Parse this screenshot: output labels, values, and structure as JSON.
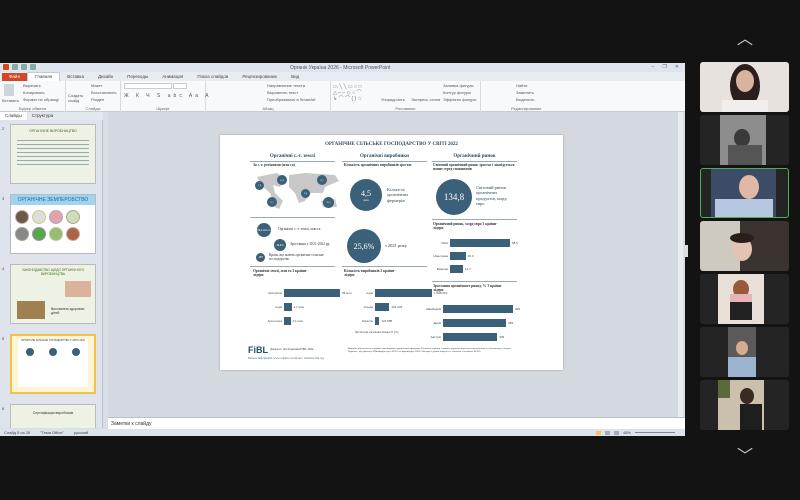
{
  "window": {
    "title": "Органік Україна 2026 - Microsoft PowerPoint",
    "controls": [
      "–",
      "❐",
      "✕"
    ]
  },
  "tabs": [
    "Файл",
    "Главная",
    "Вставка",
    "Дизайн",
    "Переходы",
    "Анимация",
    "Показ слайдов",
    "Рецензирование",
    "Вид"
  ],
  "ribbon": {
    "clipboard": {
      "paste": "Вставить",
      "cut": "Вырезать",
      "copy": "Копировать",
      "format": "Формат по образцу",
      "label": "Буфер обмена"
    },
    "slides": {
      "new": "Создать слайд",
      "layout": "Макет",
      "reset": "Восстановить",
      "section": "Раздел",
      "label": "Слайды"
    },
    "font": {
      "label": "Шрифт"
    },
    "paragraph": {
      "dir": "Направление текста",
      "align": "Выровнять текст",
      "smartart": "Преобразовать в SmartArt",
      "label": "Абзац"
    },
    "drawing": {
      "arrange": "Упорядочить",
      "styles": "Экспресс-стили",
      "fill": "Заливка фигуры",
      "outline": "Контур фигуры",
      "effects": "Эффекты фигуры",
      "label": "Рисование"
    },
    "editing": {
      "find": "Найти",
      "replace": "Заменить",
      "select": "Выделить",
      "label": "Редактирование"
    }
  },
  "panes": {
    "slides_tab": "Слайды",
    "outline_tab": "Структура"
  },
  "thumbnails": [
    {
      "num": "2",
      "title": "ОРГАНІЧНЕ ВИРОБНИЦТВО"
    },
    {
      "num": "3",
      "title": "ОРГАНІЧНЕ ЗЕМЛЕРОБСТВО"
    },
    {
      "num": "4",
      "title": "ЗАКОНОДАВСТВО ЩОДО ОРГАНІЧНОГО ВИРОБНИЦТВА",
      "caption": "Виховання здорових дітей"
    },
    {
      "num": "5",
      "title": "ОРГАНІЧНЕ СІЛЬСЬКЕ ГОСПОДАРСТВО У СВІТІ 2022"
    },
    {
      "num": "6",
      "title": "Сертифікація виробників"
    }
  ],
  "slide": {
    "title": "ОРГАНІЧНЕ СІЛЬСЬКЕ ГОСПОДАРСТВО У СВІТІ 2022",
    "col1": {
      "header": "Органічні с.-г. землі",
      "sub": "За с.-г. регіонами (млн га)",
      "regions": [
        "7,6",
        "10,5",
        "9,7",
        "2,7",
        "9,8",
        "35,2"
      ],
      "land_value": "96,4 млн га",
      "land_text": "Органічні с.-г. землі, млн га",
      "growth_value": "26,6%",
      "growth_text": "Зростання у 2021-2022 рр",
      "countries_value": "188",
      "countries_text": "Країн, що мають органічне сільське господарство",
      "chart_title": "Органічні землі, млн га 3 країни-лідери",
      "bars": [
        {
          "label": "Австралія",
          "value": 35,
          "text": "35 млн"
        },
        {
          "label": "Індія",
          "value": 4.7,
          "text": "4,7 млн"
        },
        {
          "label": "Аргентина",
          "value": 4.1,
          "text": "4,1 млн"
        }
      ]
    },
    "col2": {
      "header": "Органічні виробники",
      "sub": "Кількість органічних виробників зростає",
      "farmers_value": "4,5",
      "farmers_unit": "млн",
      "farmers_text": "Кількість органічних фермерів",
      "growth_value": "25,6%",
      "growth_text": "з 2021 року",
      "chart_title": "Кількість виробників 3 країни-лідери",
      "bars": [
        {
          "label": "Індія",
          "value": 1599010,
          "text": "1 599 010"
        },
        {
          "label": "Уганда",
          "value": 404246,
          "text": "404 246"
        },
        {
          "label": "Ефіопія",
          "value": 121685,
          "text": "121 685"
        }
      ],
      "note": "Частка від загальної кількості (%)"
    },
    "col3": {
      "header": "Органічний ринок",
      "sub": "Світовий органічний ринок зростає і ліквідується попит серед споживачів",
      "market_value": "134,8",
      "market_text": "Світовий ринок органічних продуктів, млрд євро",
      "chart1_title": "Органічний ринок, млрд євро 3 країни-лідери",
      "bars1": [
        {
          "label": "США",
          "value": 58.6,
          "text": "58,6"
        },
        {
          "label": "Німеччина",
          "value": 15.3,
          "text": "15,3"
        },
        {
          "label": "Франція",
          "value": 12.7,
          "text": "12,7"
        }
      ],
      "chart2_title": "Зростання органічного ринку, % 3 країни-лідери",
      "bars2": [
        {
          "label": "Швейцарія",
          "value": 425,
          "text": "425"
        },
        {
          "label": "Данія",
          "value": 384,
          "text": "384"
        },
        {
          "label": "Австрія",
          "value": 329,
          "text": "329"
        }
      ]
    },
    "logo": "FiBL",
    "source": "Джерело: Дослідження FiBL 2024",
    "more": "Більше інформації: www.organic-world.net / statistics.fibl.org",
    "footnote": "Видання підготовлене в рамках швейцарсько-української програми «Розвиток торгівлі з вищою доданою вартістю в органічному та молочному секторах України», яку фінансує Швейцарія через SECO та впроваджує FiBL. Погляди і думки можуть не збігатися з позицією SECO."
  },
  "notes_placeholder": "Заметки к слайду",
  "status": {
    "slide": "Слайд 5 из 28",
    "theme": "\"Тема Office\"",
    "lang": "русский",
    "zoom": "48%"
  },
  "participants": [
    {
      "name": "participant-1"
    },
    {
      "name": "participant-2"
    },
    {
      "name": "participant-3",
      "speaking": true
    },
    {
      "name": "participant-4"
    },
    {
      "name": "participant-5"
    },
    {
      "name": "participant-6"
    },
    {
      "name": "participant-7"
    }
  ],
  "nav": {
    "up": "︿",
    "down": "﹀"
  }
}
